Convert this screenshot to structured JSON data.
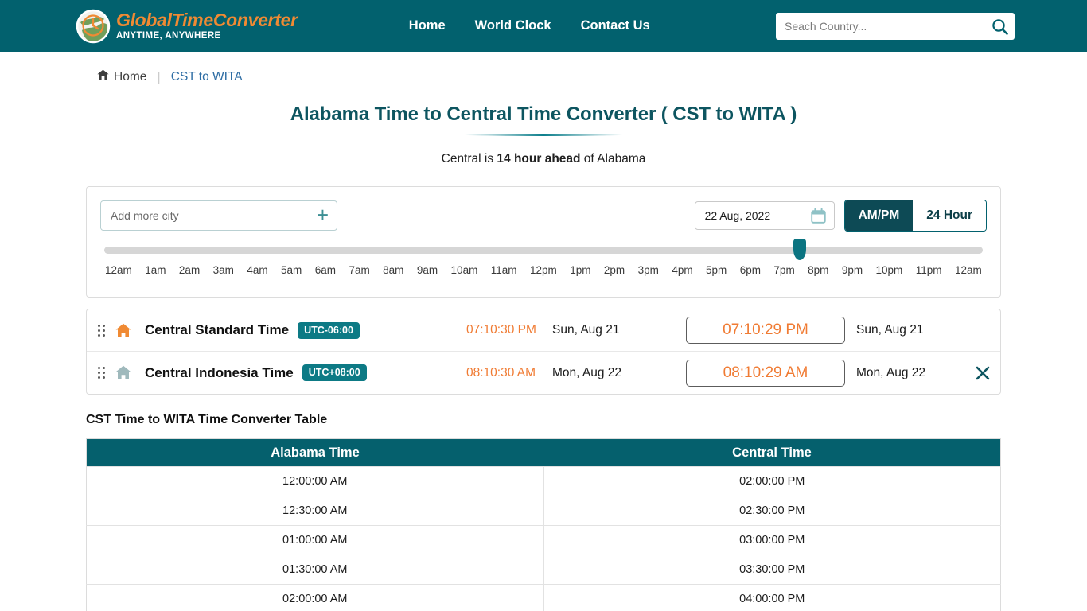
{
  "header": {
    "logo": {
      "icon": "globe-clock-icon",
      "title_part1": "Global",
      "title_part2": "Time",
      "title_part3": "Converter",
      "title_full": "GlobalTimeConverter",
      "tagline": "ANYTIME, ANYWHERE"
    },
    "nav": [
      {
        "label": "Home",
        "name": "nav-home"
      },
      {
        "label": "World Clock",
        "name": "nav-world-clock"
      },
      {
        "label": "Contact Us",
        "name": "nav-contact-us"
      }
    ],
    "search": {
      "placeholder": "Seach Country...",
      "value": "",
      "icon": "search-icon"
    },
    "bg_color": "#02616e"
  },
  "breadcrumb": {
    "home_label": "Home",
    "separator": "|",
    "current_label": "CST to WITA"
  },
  "page": {
    "title": "Alabama Time to Central Time Converter ( CST to WITA )",
    "subtitle_prefix": "Central is ",
    "subtitle_bold": "14 hour ahead",
    "subtitle_suffix": " of Alabama"
  },
  "converter": {
    "add_city": {
      "placeholder": "Add more city",
      "value": "",
      "plus_icon": "plus-icon"
    },
    "date": {
      "value": "22 Aug, 2022",
      "icon": "calendar-icon"
    },
    "format_toggle": {
      "options": [
        {
          "label": "AM/PM",
          "active": true
        },
        {
          "label": "24 Hour",
          "active": false
        }
      ]
    },
    "slider": {
      "thumb_percent": 79.2,
      "thumb_label": "7pm",
      "labels": [
        "12am",
        "1am",
        "2am",
        "3am",
        "4am",
        "5am",
        "6am",
        "7am",
        "8am",
        "9am",
        "10am",
        "11am",
        "12pm",
        "1pm",
        "2pm",
        "3pm",
        "4pm",
        "5pm",
        "6pm",
        "7pm",
        "8pm",
        "9pm",
        "10pm",
        "11pm",
        "12am"
      ]
    }
  },
  "timezones": [
    {
      "name": "Central Standard Time",
      "utc_offset": "UTC-06:00",
      "home_icon_color": "#f08a33",
      "is_home": true,
      "time_plain": "07:10:30 PM",
      "date_plain": "Sun, Aug 21",
      "time_boxed": "07:10:29 PM",
      "date_right": "Sun, Aug 21",
      "removable": false
    },
    {
      "name": "Central Indonesia Time",
      "utc_offset": "UTC+08:00",
      "home_icon_color": "#9fb9bc",
      "is_home": false,
      "time_plain": "08:10:30 AM",
      "date_plain": "Mon, Aug 22",
      "time_boxed": "08:10:29 AM",
      "date_right": "Mon, Aug 22",
      "removable": true
    }
  ],
  "table": {
    "heading": "CST Time to WITA Time Converter Table",
    "columns": [
      "Alabama Time",
      "Central Time"
    ],
    "rows": [
      [
        "12:00:00 AM",
        "02:00:00 PM"
      ],
      [
        "12:30:00 AM",
        "02:30:00 PM"
      ],
      [
        "01:00:00 AM",
        "03:00:00 PM"
      ],
      [
        "01:30:00 AM",
        "03:30:00 PM"
      ],
      [
        "02:00:00 AM",
        "04:00:00 PM"
      ]
    ]
  },
  "colors": {
    "teal": "#02616e",
    "orange": "#f08a33",
    "link_blue": "#2e6da4",
    "badge_teal": "#0d7a85"
  }
}
